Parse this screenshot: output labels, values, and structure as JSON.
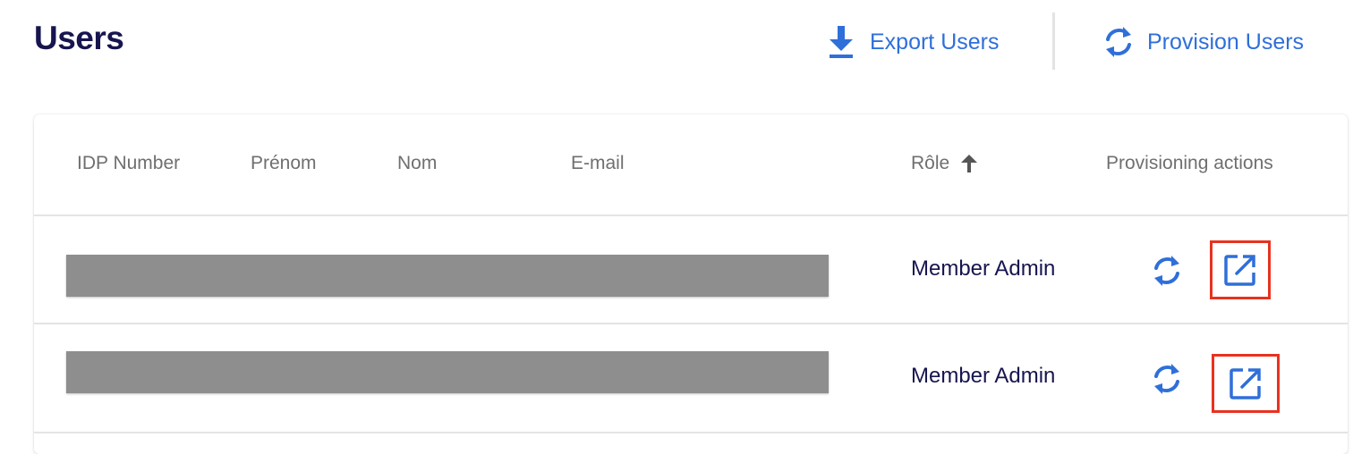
{
  "page": {
    "title": "Users"
  },
  "header_actions": {
    "export_label": "Export Users",
    "export_icon": "download-icon",
    "provision_label": "Provision Users",
    "provision_icon": "sync-icon"
  },
  "table": {
    "columns": [
      {
        "label": "IDP Number"
      },
      {
        "label": "Prénom"
      },
      {
        "label": "Nom"
      },
      {
        "label": "E-mail"
      },
      {
        "label": "Rôle",
        "sort": "ascending",
        "sort_icon": "arrow-up-icon"
      },
      {
        "label": "Provisioning actions"
      }
    ],
    "rows": [
      {
        "role": "Member Admin",
        "details_redacted": true,
        "actions": [
          "sync-icon",
          "open-in-new-icon"
        ]
      },
      {
        "role": "Member Admin",
        "details_redacted": true,
        "actions": [
          "sync-icon",
          "open-in-new-icon"
        ]
      }
    ]
  },
  "colors": {
    "title": "#17154f",
    "accent": "#2f6fd9",
    "highlight_border": "#e8321f",
    "redaction": "#8e8e8e"
  }
}
